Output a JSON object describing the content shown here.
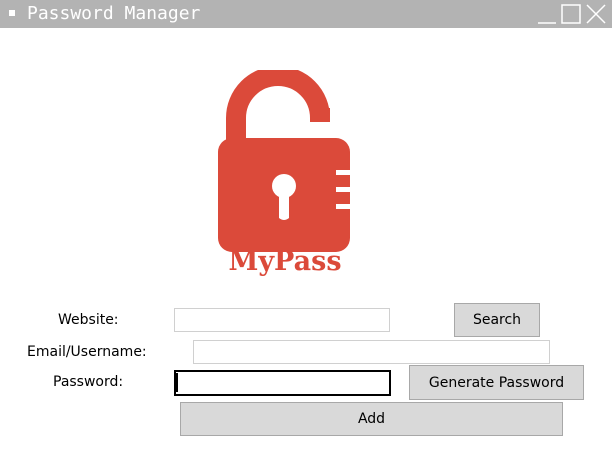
{
  "window": {
    "title": "Password Manager"
  },
  "logo": {
    "text": "MyPass",
    "color": "#db4a3a",
    "icon": "unlocked-padlock-icon"
  },
  "form": {
    "website_label": "Website:",
    "website_value": "",
    "email_label": "Email/Username:",
    "email_value": "",
    "password_label": "Password:",
    "password_value": ""
  },
  "buttons": {
    "search": "Search",
    "generate": "Generate Password",
    "add": "Add"
  }
}
